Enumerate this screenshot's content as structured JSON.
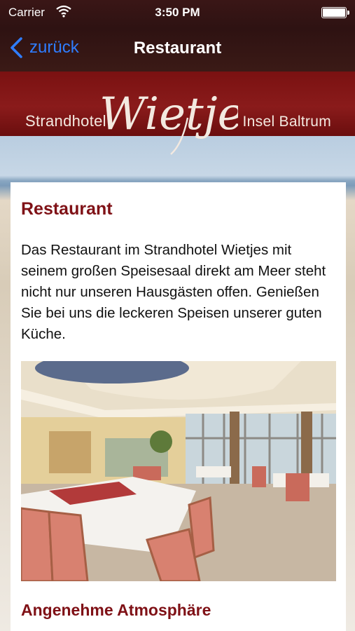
{
  "status_bar": {
    "carrier": "Carrier",
    "time": "3:50 PM",
    "icons": [
      "wifi-icon",
      "battery-icon"
    ]
  },
  "nav": {
    "back_label": "zurück",
    "title": "Restaurant",
    "back_icon": "chevron-left-icon",
    "accent": "#2f7dff"
  },
  "banner": {
    "left_text": "Strandhotel",
    "script_text": "Wietjes",
    "right_text": "Insel Baltrum",
    "color": "#7a1111"
  },
  "content": {
    "heading": "Restaurant",
    "paragraph": "Das Restaurant im Strandhotel Wietjes mit seinem großen Speisesaal direkt am Meer steht nicht nur unseren Hausgästen offen. Genießen Sie bei uns die leckeren Speisen unserer guten Küche.",
    "photo": "restaurant-dining-room-photo",
    "subheading": "Angenehme Atmosphäre",
    "heading_color": "#7f1116"
  }
}
